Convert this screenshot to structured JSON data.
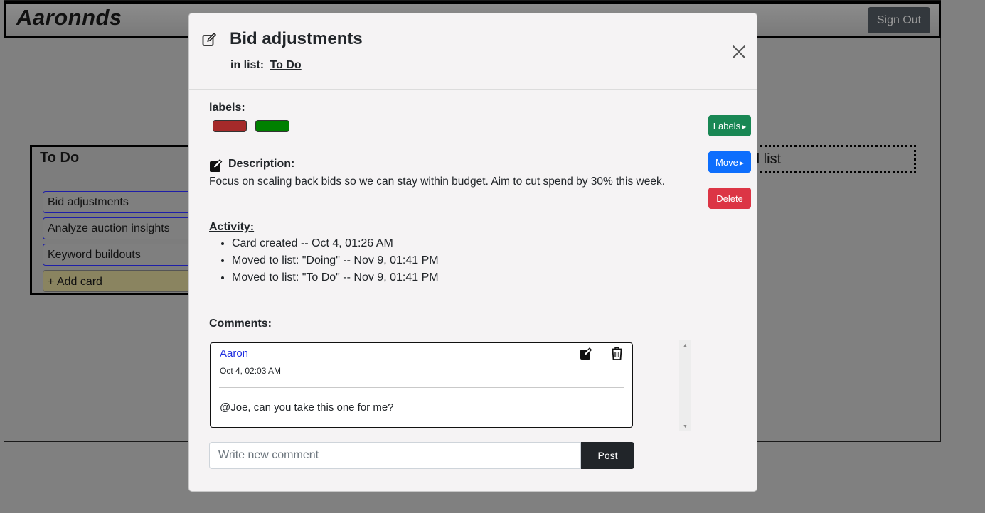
{
  "app": {
    "brand": "Aaronnds",
    "sign_out_label": "Sign Out"
  },
  "board": {
    "list": {
      "title": "To Do",
      "cards": [
        "Bid adjustments",
        "Analyze auction insights",
        "Keyword buildouts"
      ],
      "add_card_label": "+ Add card"
    },
    "add_list_label": "d list"
  },
  "modal": {
    "title": "Bid adjustments",
    "in_list_prefix": "in list:",
    "in_list_name": "To Do",
    "labels_heading": "labels:",
    "label_colors": [
      "#a52a2a",
      "#008000"
    ],
    "description_heading": "Description:",
    "description_text": "Focus on scaling back bids so we can stay within budget. Aim to cut spend by 30% this week.",
    "activity_heading": "Activity:",
    "activity": [
      "Card created -- Oct 4, 01:26 AM",
      "Moved to list: \"Doing\" -- Nov 9, 01:41 PM",
      "Moved to list: \"To Do\" -- Nov 9, 01:41 PM"
    ],
    "comments_heading": "Comments:",
    "comments": [
      {
        "author": "Aaron",
        "time": "Oct 4, 02:03 AM",
        "text": "@Joe, can you take this one for me?"
      }
    ],
    "comment_placeholder": "Write new comment",
    "post_label": "Post",
    "buttons": {
      "labels": "Labels",
      "move": "Move",
      "delete": "Delete"
    },
    "button_colors": {
      "labels": "#198754",
      "move": "#0d6efd",
      "delete": "#dc3545"
    }
  }
}
